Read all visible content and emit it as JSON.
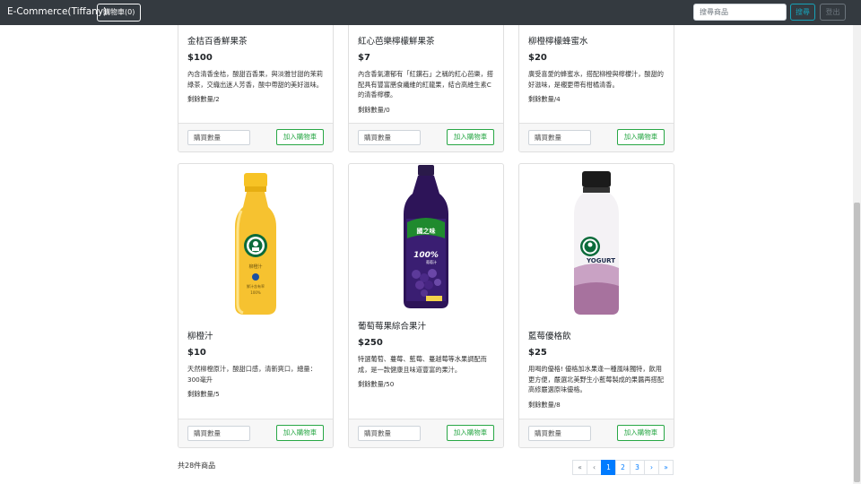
{
  "navbar": {
    "brand": "E-Commerce(Tiffany)",
    "cart_label": "購物車(0)",
    "search_placeholder": "搜尋商品",
    "search_label": "搜尋",
    "logout_label": "登出"
  },
  "products": [
    {
      "name": "金桔百香鮮果茶",
      "price": "$100",
      "desc": "內含清香金桔，酸甜百香果，與淡雅甘甜的茉莉綠茶，交織出迷人芳香，酸中帶甜的美好滋味。",
      "stock": "剩餘數量/2",
      "qty_placeholder": "購買數量",
      "add_label": "加入購物車"
    },
    {
      "name": "紅心芭樂檸檬鮮果茶",
      "price": "$7",
      "desc": "內含香氣濃郁有「紅鑽石」之稱的紅心芭樂，搭配具有豐富膳食纖維的紅龍果，結合高維生素C的清香檸檬。",
      "stock": "剩餘數量/0",
      "qty_placeholder": "購買數量",
      "add_label": "加入購物車"
    },
    {
      "name": "柳橙檸檬蜂蜜水",
      "price": "$20",
      "desc": "廣受喜愛的蜂蜜水，搭配柳橙與檸檬汁，酸甜的好滋味，是襯更帶有柑橘清香。",
      "stock": "剩餘數量/4",
      "qty_placeholder": "購買數量",
      "add_label": "加入購物車"
    },
    {
      "name": "柳橙汁",
      "price": "$10",
      "desc": "天然柳橙原汁，酸甜口感，清新爽口，總量：300毫升",
      "stock": "剩餘數量/5",
      "qty_placeholder": "購買數量",
      "add_label": "加入購物車"
    },
    {
      "name": "葡萄莓果綜合果汁",
      "price": "$250",
      "desc": "特選葡萄、蔓莓、藍莓、蔓越莓等水果調配而成，是一款健康且味道豐富的果汁。",
      "stock": "剩餘數量/50",
      "qty_placeholder": "購買數量",
      "add_label": "加入購物車"
    },
    {
      "name": "藍莓優格飲",
      "price": "$25",
      "desc": "用喝的優格! 優格加水果逢一種風味獨特，飲用更方便，嚴選北美野生小藍莓製成的果醬再搭配高修嚴選原味優格。",
      "stock": "剩餘數量/8",
      "qty_placeholder": "購買數量",
      "add_label": "加入購物車"
    }
  ],
  "bottle_labels": {
    "orange_name": "柳橙汁",
    "orange_sub": "鮮汁含有率",
    "orange_pct": "100%",
    "grape_brand": "國之味",
    "grape_pct": "100%",
    "grape_sub": "葡萄汁",
    "yogurt_name": "YOGURT"
  },
  "footer": {
    "total": "共28件商品"
  },
  "pagination": [
    "«",
    "‹",
    "1",
    "2",
    "3",
    "›",
    "»"
  ],
  "pagination_active": "1",
  "colors": {
    "navbar": "#343a40",
    "success": "#28a745",
    "info": "#17a2b8",
    "primary": "#007bff"
  }
}
